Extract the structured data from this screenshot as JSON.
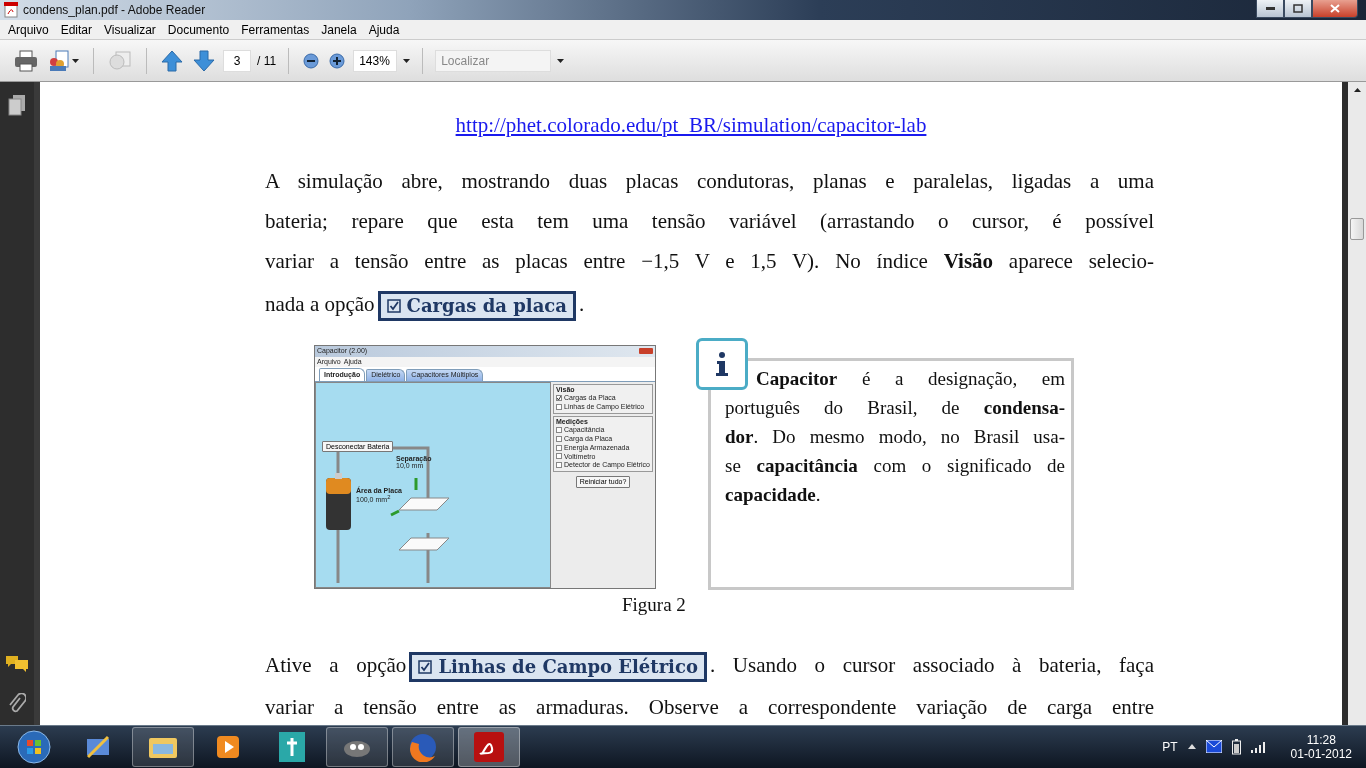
{
  "window": {
    "title": "condens_plan.pdf - Adobe Reader"
  },
  "menu": [
    "Arquivo",
    "Editar",
    "Visualizar",
    "Documento",
    "Ferramentas",
    "Janela",
    "Ajuda"
  ],
  "toolbar": {
    "page": "3",
    "page_total": "/ 11",
    "zoom": "143%",
    "search_placeholder": "Localizar"
  },
  "document": {
    "link": "http://phet.colorado.edu/pt_BR/simulation/capacitor-lab",
    "intro": {
      "lines": [
        {
          "parts": [
            {
              "kind": "text",
              "text": "A simulação abre, mostrando duas placas condutoras, planas e paralelas, ligadas a uma"
            }
          ]
        },
        {
          "parts": [
            {
              "kind": "text",
              "text": "bateria; repare que esta tem uma tensão variável (arrastando o cursor, é possível"
            }
          ]
        },
        {
          "parts": [
            {
              "kind": "text",
              "text": "variar a tensão entre as placas entre −1,5 V e 1,5 V). No índice **Visão** aparece selecio-"
            }
          ]
        },
        {
          "parts": [
            {
              "kind": "text",
              "text": "nada a opção"
            },
            {
              "kind": "option",
              "text": "Cargas da placa",
              "checked": true
            },
            {
              "kind": "text",
              "text": "."
            }
          ]
        }
      ]
    },
    "figure": {
      "title": "Capacitor (2.00)",
      "menu": [
        "Arquivo",
        "Ajuda"
      ],
      "tabs": [
        {
          "label": "Introdução",
          "selected": true
        },
        {
          "label": "Dielétrico",
          "selected": false
        },
        {
          "label": "Capacitores Múltiplos",
          "selected": false
        }
      ],
      "disconnect_button": "Desconectar Bateria",
      "separation_label": "Separação",
      "separation_value": "10,0 mm",
      "area_label": "Área da Placa",
      "area_value": "100,0 mm$^{2}$",
      "groups": [
        {
          "title": "Visão",
          "options": [
            {
              "label": "Cargas da Placa",
              "checked": true
            },
            {
              "label": "Linhas de Campo Elétrico",
              "checked": false
            }
          ]
        },
        {
          "title": "Medições",
          "options": [
            {
              "label": "Capacitância",
              "checked": false
            },
            {
              "label": "Carga da Placa",
              "checked": false
            },
            {
              "label": "Energia Armazenada",
              "checked": false
            },
            {
              "label": "Voltímetro",
              "checked": false
            },
            {
              "label": "Detector de Campo Elétrico",
              "checked": false
            }
          ]
        }
      ],
      "reset_button": "Reiniciar tudo?"
    },
    "caption": "Figura 2",
    "info_box": {
      "lines": [
        {
          "text": "**Capacitor** é a designação, em"
        },
        {
          "text": "português do Brasil, de **condensa-**"
        },
        {
          "text": "**dor**. Do mesmo modo, no Brasil usa-"
        },
        {
          "text": "se **capacitância** com o significado de"
        },
        {
          "text": "**capacidade**."
        }
      ]
    },
    "outro": {
      "lines": [
        {
          "parts": [
            {
              "kind": "text",
              "text": "Ative a opção"
            },
            {
              "kind": "option",
              "text": "Linhas de Campo Elétrico",
              "checked": true
            },
            {
              "kind": "text",
              "text": ". Usando o cursor associado à bateria, faça"
            }
          ]
        },
        {
          "parts": [
            {
              "kind": "text",
              "text": "variar a tensão entre as armaduras. Observe a correspondente variação de carga entre"
            }
          ]
        }
      ]
    }
  },
  "taskbar": {
    "language": "PT",
    "time": "11:28",
    "date": "01-01-2012"
  }
}
